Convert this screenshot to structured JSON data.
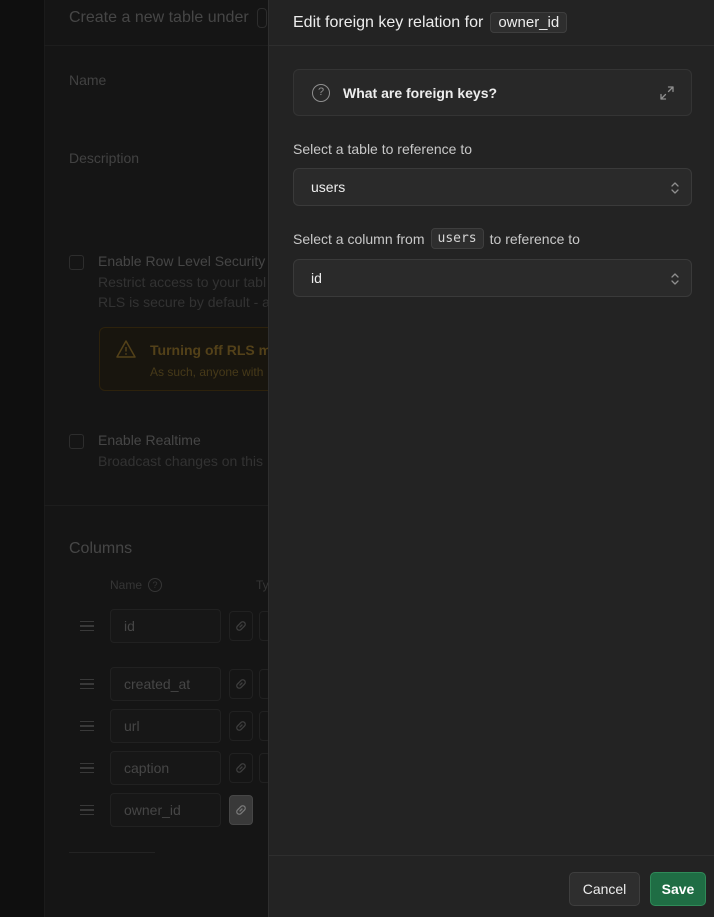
{
  "background": {
    "title": "Create a new table under",
    "name_label": "Name",
    "description_label": "Description",
    "rls": {
      "title": "Enable Row Level Security",
      "sub1": "Restrict access to your tabl",
      "sub2": "RLS is secure by default - a"
    },
    "warning": {
      "title": "Turning off RLS me",
      "sub": "As such, anyone with"
    },
    "realtime": {
      "title": "Enable Realtime",
      "sub": "Broadcast changes on this"
    },
    "columns": {
      "title": "Columns",
      "header_name": "Name",
      "header_type": "Ty",
      "rows": [
        "id",
        "created_at",
        "url",
        "caption",
        "owner_id"
      ]
    }
  },
  "panel": {
    "title": "Edit foreign key relation for",
    "column_chip": "owner_id",
    "accordion": {
      "title": "What are foreign keys?",
      "icon": "question-circle-icon"
    },
    "table_select": {
      "label": "Select a table to reference to",
      "value": "users"
    },
    "column_select": {
      "label_prefix": "Select a column from",
      "label_table": "users",
      "label_suffix": "to reference to",
      "value": "id"
    },
    "footer": {
      "cancel_label": "Cancel",
      "save_label": "Save"
    }
  },
  "colors": {
    "panel_bg": "#232323",
    "save_green": "#1f6d44",
    "warning_amber": "#6b5420"
  }
}
